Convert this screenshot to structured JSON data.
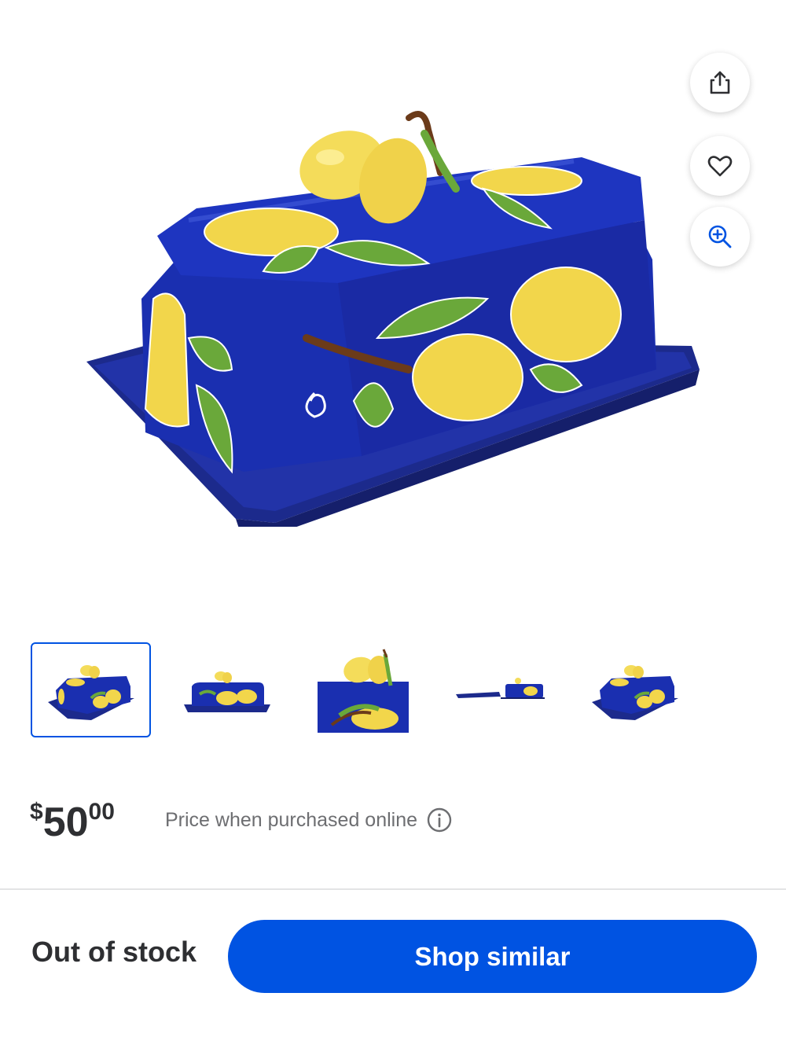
{
  "product": {
    "image_alt": "Blue ceramic butter dish with painted lemons",
    "thumbnail_count": 5,
    "selected_thumbnail": 1
  },
  "actions": {
    "share_icon": "share-icon",
    "favorite_icon": "heart-icon",
    "zoom_icon": "zoom-in-icon"
  },
  "price": {
    "currency": "$",
    "whole": "50",
    "cents": "00",
    "note": "Price when purchased online",
    "info_icon": "info-icon"
  },
  "footer": {
    "stock_status": "Out of stock",
    "cta_label": "Shop similar"
  },
  "colors": {
    "brand_blue": "#0053e2",
    "text_dark": "#2e2f32",
    "text_muted": "#6d6e71",
    "dish_blue": "#1f2fa8",
    "lemon_yellow": "#f2d64b",
    "leaf_green": "#6aa83a"
  }
}
